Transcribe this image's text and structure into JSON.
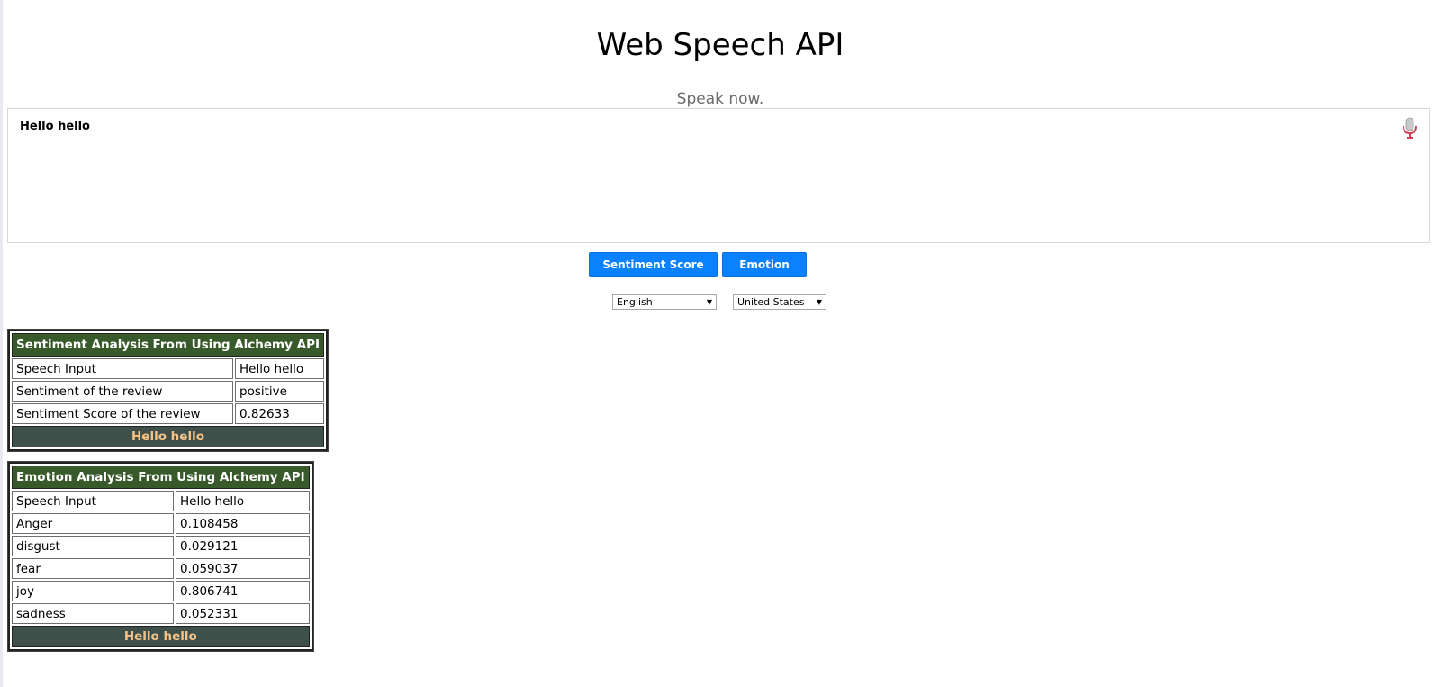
{
  "header": {
    "title": "Web Speech API",
    "info": "Speak now."
  },
  "results": {
    "final_text": "Hello hello",
    "mic_icon": "microphone-icon"
  },
  "actions": {
    "sentiment_label": "Sentiment Score",
    "emotion_label": "Emotion"
  },
  "selects": {
    "language": "English",
    "dialect": "United States"
  },
  "sentiment_table": {
    "caption": "Sentiment Analysis From Using Alchemy API",
    "rows": [
      {
        "label": "Speech Input",
        "value": "Hello hello"
      },
      {
        "label": "Sentiment of the review",
        "value": "positive"
      },
      {
        "label": "Sentiment Score of the review",
        "value": "0.82633"
      }
    ],
    "footer": "Hello hello"
  },
  "emotion_table": {
    "caption": "Emotion Analysis From Using Alchemy API",
    "rows": [
      {
        "label": "Speech Input",
        "value": "Hello hello"
      },
      {
        "label": "Anger",
        "value": "0.108458"
      },
      {
        "label": "disgust",
        "value": "0.029121"
      },
      {
        "label": "fear",
        "value": "0.059037"
      },
      {
        "label": "joy",
        "value": "0.806741"
      },
      {
        "label": "sadness",
        "value": "0.052331"
      }
    ],
    "footer": "Hello hello"
  },
  "colors": {
    "button_blue": "#0a82ff",
    "table_header_green": "#385929",
    "table_footer_slate": "#3f4f4a",
    "table_footer_text": "#f2c48a",
    "mic_red": "#d43f57"
  }
}
